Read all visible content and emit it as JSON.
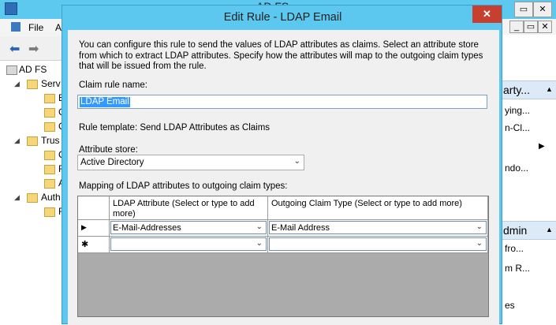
{
  "background_window": {
    "title": "AD FS",
    "menu": [
      "File",
      "A"
    ],
    "tree": [
      {
        "label": "AD FS",
        "indent": 0,
        "arrow": ""
      },
      {
        "label": "Serv",
        "indent": 1,
        "arrow": "◢"
      },
      {
        "label": "E",
        "indent": 2,
        "arrow": ""
      },
      {
        "label": "C",
        "indent": 2,
        "arrow": ""
      },
      {
        "label": "C",
        "indent": 2,
        "arrow": ""
      },
      {
        "label": "Trus",
        "indent": 1,
        "arrow": "◢"
      },
      {
        "label": "C",
        "indent": 2,
        "arrow": ""
      },
      {
        "label": "R",
        "indent": 2,
        "arrow": ""
      },
      {
        "label": "A",
        "indent": 2,
        "arrow": ""
      },
      {
        "label": "Auth",
        "indent": 1,
        "arrow": "◢"
      },
      {
        "label": "F",
        "indent": 2,
        "arrow": ""
      }
    ],
    "actions": {
      "header1": "arty...",
      "items1": [
        "ying...",
        "n-Cl...",
        "ndo..."
      ],
      "header2": "dmin",
      "items2": [
        "fro...",
        "m R...",
        "es"
      ]
    }
  },
  "dialog": {
    "title": "Edit Rule - LDAP Email",
    "close_glyph": "✕",
    "description": "You can configure this rule to send the values of LDAP attributes as claims. Select an attribute store from which to extract LDAP attributes. Specify how the attributes will map to the outgoing claim types that will be issued from the rule.",
    "claim_rule_name_label": "Claim rule name:",
    "claim_rule_name_value": "LDAP Email",
    "rule_template_text": "Rule template: Send LDAP Attributes as Claims",
    "attribute_store_label": "Attribute store:",
    "attribute_store_value": "Active Directory",
    "mapping_label": "Mapping of LDAP attributes to outgoing claim types:",
    "grid": {
      "columns": [
        "LDAP Attribute (Select or type to add more)",
        "Outgoing Claim Type (Select or type to add more)"
      ],
      "rows": [
        {
          "marker": "▶",
          "ldap_attribute": "E-Mail-Addresses",
          "claim_type": "E-Mail Address"
        },
        {
          "marker": "✱",
          "ldap_attribute": "",
          "claim_type": ""
        }
      ]
    }
  },
  "colors": {
    "dialog_frame": "#5cc7ef",
    "close_button": "#c7402f",
    "selection": "#3399ff",
    "grid_empty_area": "#ababab"
  }
}
